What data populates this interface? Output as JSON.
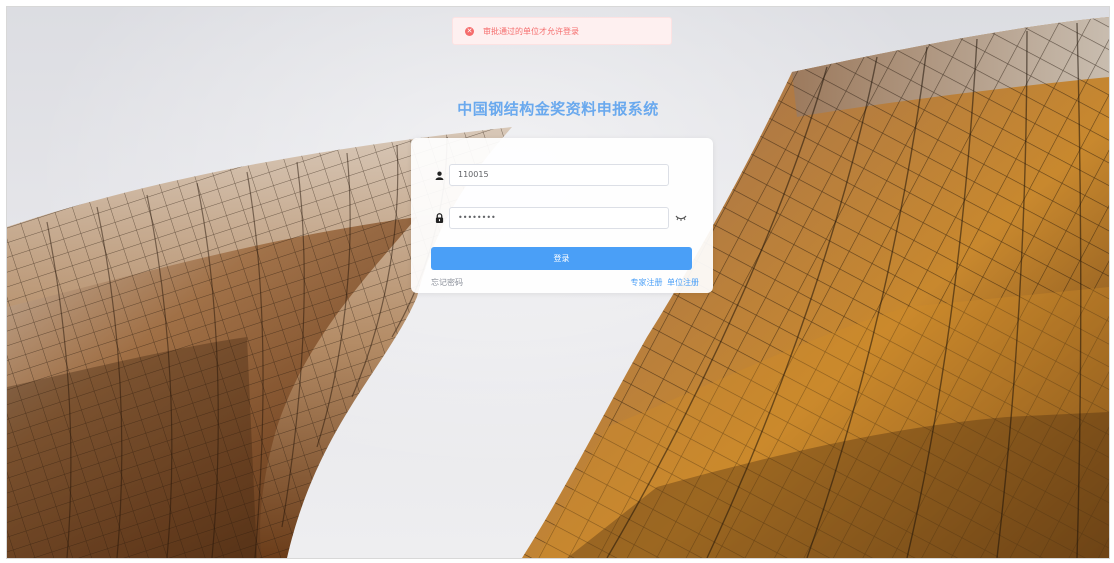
{
  "alert": {
    "icon": "close-circle-icon",
    "message": "审批通过的单位才允许登录",
    "color": "#f56c6c"
  },
  "page": {
    "title": "中国钢结构金奖资料申报系统"
  },
  "login_form": {
    "username": {
      "icon": "user-icon",
      "value": "110015"
    },
    "password": {
      "icon": "lock-icon",
      "value": "••••••••",
      "toggle_icon": "eye-closed-icon"
    },
    "submit_label": "登录",
    "forgot_password": "忘记密码",
    "expert_register": "专家注册",
    "unit_register": "单位注册",
    "accent_color": "#4a9ff7"
  }
}
